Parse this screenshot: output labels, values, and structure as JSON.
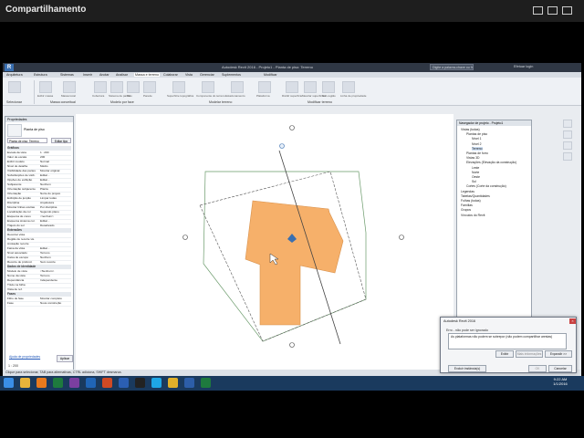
{
  "share": {
    "title": "Compartilhamento"
  },
  "revit": {
    "window_title": "Autodesk Revit 2016 - Projeto1 - Planta de piso: Terreno",
    "search_placeholder": "Digite a palavra-chave ou frase",
    "signin": "Efetuar login",
    "menu": [
      "Arquitetura",
      "Estrutura",
      "Sistemas",
      "Inserir",
      "Anotar",
      "Analisar",
      "Massa e terreno",
      "Colaborar",
      "Vista",
      "Gerenciar",
      "Suplementos",
      "Modificar"
    ],
    "ribbon_panels": [
      {
        "title": "Massa conceitual",
        "buttons": [
          "Exibir massa",
          "Massa local"
        ]
      },
      {
        "title": "Modelo por face",
        "buttons": [
          "Cobertura",
          "Sistema de painel",
          "Piso",
          "Parede"
        ]
      },
      {
        "title": "Modelar terreno",
        "buttons": [
          "Superfície topográfica",
          "Componente do terreno",
          "Estacionamento",
          "Plataforma"
        ]
      },
      {
        "title": "Modificar terreno",
        "buttons": [
          "Dividir superfície",
          "Mesclar superfícies",
          "Sub-região",
          "Linha de propriedade"
        ]
      }
    ],
    "modify_label": "Selecionar"
  },
  "properties": {
    "title": "Propriedades",
    "type": "Planta de piso",
    "view_selector": "Planta de piso: Terreno",
    "edit_type": "Editar tipo",
    "sections": [
      {
        "name": "Gráficos",
        "rows": [
          [
            "Escala da vista",
            "1 : 200"
          ],
          [
            "Valor de escala",
            "200"
          ],
          [
            "Exibir modelo",
            "Normal"
          ],
          [
            "Nível de detalhe",
            "Médio"
          ],
          [
            "Visibilidade das partes",
            "Mostrar original"
          ],
          [
            "Substituições de visib.",
            "Editar..."
          ],
          [
            "Opções de exibição",
            "Editar..."
          ],
          [
            "Subjacente",
            "Nenhum"
          ],
          [
            "Orientação subjacente",
            "Planta"
          ],
          [
            "Orientação",
            "Norte do projeto"
          ],
          [
            "Exibição de junção",
            "Limpar todas"
          ],
          [
            "Disciplina",
            "Arquitetura"
          ],
          [
            "Mostrar linhas ocultas",
            "Por disciplina"
          ],
          [
            "Localização da cor",
            "Segundo plano"
          ],
          [
            "Esquema de cores",
            "<nenhum>"
          ],
          [
            "Esquema sistema cor.",
            "Editar..."
          ],
          [
            "Trajeto do sol",
            "Desativado"
          ]
        ]
      },
      {
        "name": "Extensões",
        "rows": [
          [
            "Recortar vista",
            ""
          ],
          [
            "Região de recorte vis.",
            ""
          ],
          [
            "Anotação recorte",
            ""
          ],
          [
            "Faixa da vista",
            "Editar..."
          ],
          [
            "Nível associado",
            "Terreno"
          ],
          [
            "Caixa de escopo",
            "Nenhum"
          ],
          [
            "Recorte de profund.",
            "Sem recorte"
          ]
        ]
      },
      {
        "name": "Dados de identidade",
        "rows": [
          [
            "Modelo de vista",
            "<Nenhum>"
          ],
          [
            "Nome da vista",
            "Terreno"
          ],
          [
            "Dependência",
            "Independente"
          ],
          [
            "Título na folha",
            ""
          ],
          [
            "Vista de ref.",
            ""
          ]
        ]
      },
      {
        "name": "Fases",
        "rows": [
          [
            "Filtro de fase",
            "Mostrar completo"
          ],
          [
            "Fase",
            "Nova construção"
          ]
        ]
      }
    ],
    "help_link": "Ajuda de propriedades",
    "apply": "Aplicar"
  },
  "browser": {
    "title": "Navegador de projeto - Projeto1",
    "items": [
      {
        "label": "Vistas (todas)",
        "level": 0
      },
      {
        "label": "Plantas de piso",
        "level": 1
      },
      {
        "label": "Nível 1",
        "level": 2
      },
      {
        "label": "Nível 2",
        "level": 2
      },
      {
        "label": "Terreno",
        "level": 2
      },
      {
        "label": "Plantas de forro",
        "level": 1
      },
      {
        "label": "Vistas 3D",
        "level": 1
      },
      {
        "label": "Elevações (Elevação da construção)",
        "level": 1
      },
      {
        "label": "Leste",
        "level": 2
      },
      {
        "label": "Norte",
        "level": 2
      },
      {
        "label": "Oeste",
        "level": 2
      },
      {
        "label": "Sul",
        "level": 2
      },
      {
        "label": "Cortes (Corte da construção)",
        "level": 1
      },
      {
        "label": "Legendas",
        "level": 0
      },
      {
        "label": "Tabelas/Quantidades",
        "level": 0
      },
      {
        "label": "Folhas (todas)",
        "level": 0
      },
      {
        "label": "Famílias",
        "level": 0
      },
      {
        "label": "Grupos",
        "level": 0
      },
      {
        "label": "Vínculos do Revit",
        "level": 0
      }
    ]
  },
  "status": {
    "text": "Clique para selecionar, TAB para alternativas, CTRL adiciona, SHIFT desmarca.",
    "scale": "1 : 200",
    "model": "Modelo principal"
  },
  "dialog": {
    "title": "Autodesk Revit 2016",
    "warning": "Erro - não pode ser ignorado",
    "message": "As plataformas não podem se sobrepor (não podem compartilhar arestas)",
    "buttons": {
      "show": "Exibir",
      "more": "Mais informações",
      "expand": "Expandir >>",
      "remove": "Excluir instância(s)",
      "ok": "OK",
      "cancel": "Cancelar"
    }
  },
  "taskbar": {
    "apps": [
      {
        "name": "windows-start",
        "color": "#3a8ee6"
      },
      {
        "name": "explorer",
        "color": "#e8b43a"
      },
      {
        "name": "media-player",
        "color": "#e87a1e"
      },
      {
        "name": "excel",
        "color": "#1e7a3e"
      },
      {
        "name": "onenote",
        "color": "#7b3fa0"
      },
      {
        "name": "outlook",
        "color": "#2065b6"
      },
      {
        "name": "powerpoint",
        "color": "#d04a24"
      },
      {
        "name": "word",
        "color": "#2b5fb3"
      },
      {
        "name": "cmd",
        "color": "#222222"
      },
      {
        "name": "skype",
        "color": "#1ea7e6"
      },
      {
        "name": "chrome",
        "color": "#e0b02a"
      },
      {
        "name": "revit",
        "color": "#2d5ea8"
      },
      {
        "name": "excel-2",
        "color": "#1e7a3e"
      }
    ],
    "time": "9:22 AM",
    "date": "1/1/2016"
  }
}
